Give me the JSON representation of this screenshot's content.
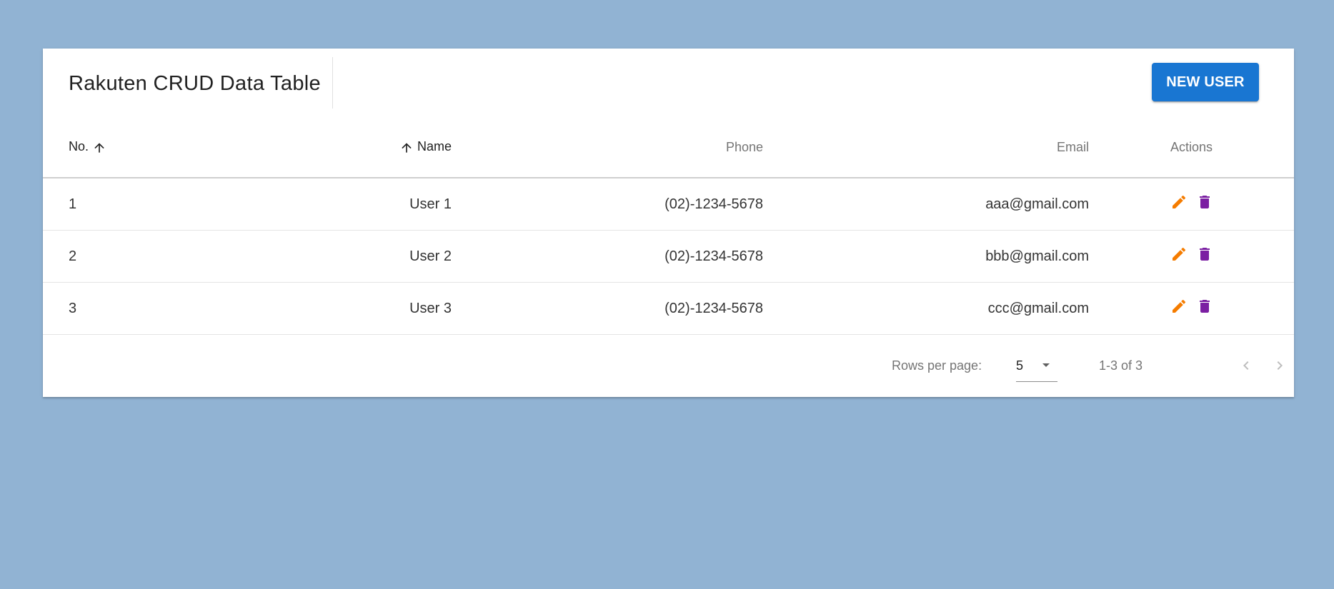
{
  "toolbar": {
    "title": "Rakuten CRUD Data Table",
    "new_user_label": "NEW USER"
  },
  "table": {
    "headers": {
      "no": "No.",
      "name": "Name",
      "phone": "Phone",
      "email": "Email",
      "actions": "Actions"
    },
    "rows": [
      {
        "no": "1",
        "name": "User 1",
        "phone": "(02)-1234-5678",
        "email": "aaa@gmail.com"
      },
      {
        "no": "2",
        "name": "User 2",
        "phone": "(02)-1234-5678",
        "email": "bbb@gmail.com"
      },
      {
        "no": "3",
        "name": "User 3",
        "phone": "(02)-1234-5678",
        "email": "ccc@gmail.com"
      }
    ]
  },
  "footer": {
    "rows_per_page_label": "Rows per page:",
    "rows_per_page_value": "5",
    "range_text": "1-3 of 3"
  },
  "icons": {
    "sort_no": "arrow-up-icon",
    "sort_name": "arrow-up-icon",
    "edit": "pencil-icon",
    "delete": "trash-icon",
    "dropdown": "caret-down-icon",
    "prev": "chevron-left-icon",
    "next": "chevron-right-icon"
  },
  "colors": {
    "background": "#91b3d3",
    "primary": "#1976d2",
    "edit_icon": "#f57c00",
    "delete_icon": "#7b1fa2"
  }
}
